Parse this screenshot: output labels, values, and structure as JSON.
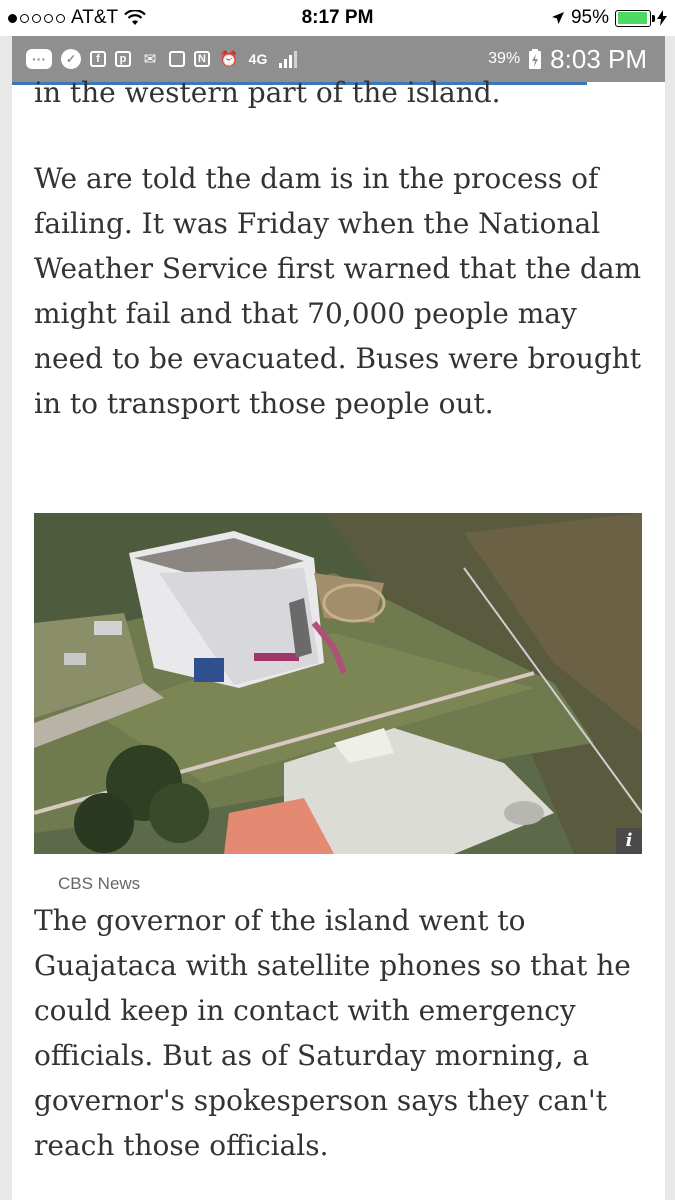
{
  "ios_status": {
    "carrier": "AT&T",
    "time": "8:17 PM",
    "battery": "95%",
    "battery_fill": 0.95,
    "signal_dots": 1
  },
  "android_status": {
    "battery": "39%",
    "time": "8:03 PM",
    "network": "4G",
    "icons": [
      "more-dots-icon",
      "app-check-icon",
      "facebook-icon",
      "pinterest-icon",
      "mail-icon",
      "screenshot-icon",
      "nfc-icon",
      "alarm-icon",
      "network-4g-icon",
      "signal-icon",
      "battery-icon"
    ]
  },
  "article": {
    "p1": "in the western part of the island.",
    "p2": "We are told the dam is in the process of failing. It was Friday when the National Weather Service first warned that the dam might fail and that 70,000 people may need to be evacuated. Buses were brought in to transport those people out.",
    "image_credit": "CBS News",
    "info_icon": "i",
    "p3": "The governor of the island went to Guajataca with satellite phones so that he could keep in contact with emergency officials. But as of Saturday morning, a governor's spokesperson says they can't reach those officials."
  }
}
